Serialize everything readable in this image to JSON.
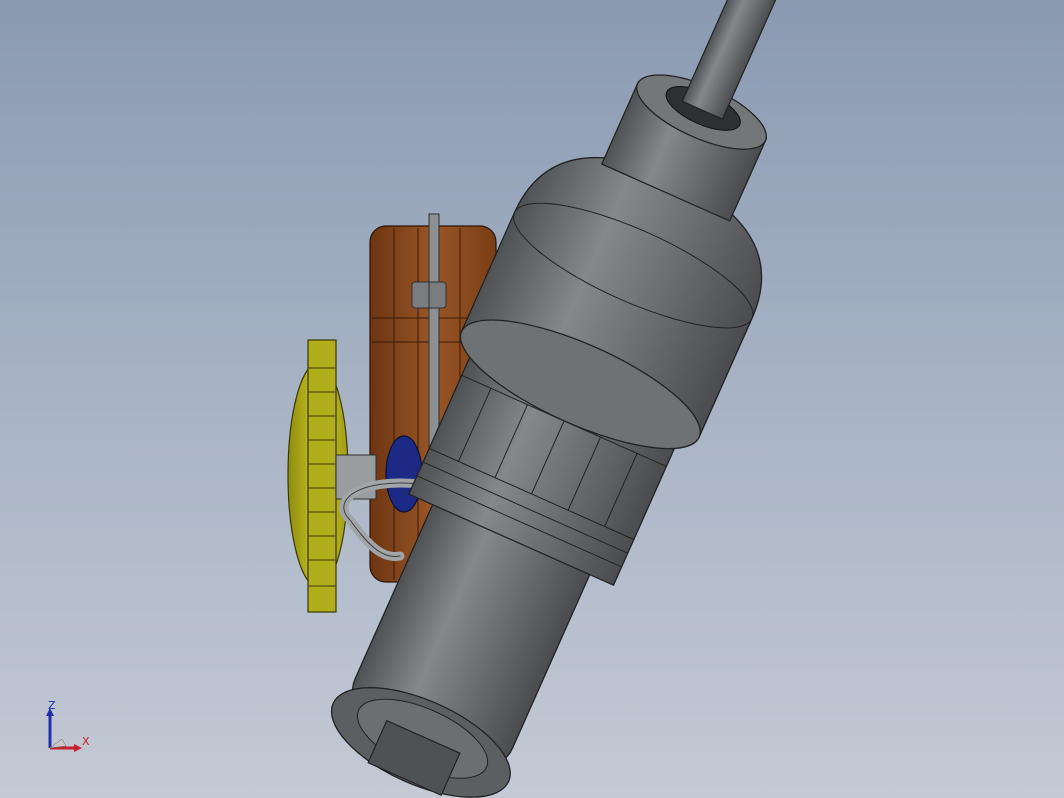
{
  "viewport": {
    "background_top": "#8a9ab1",
    "background_bottom": "#c3cad5",
    "model_colors": {
      "body_gray": "#6f7275",
      "housing_brown": "#8b4a1e",
      "blade_yellow": "#b7b41a",
      "motor_blue": "#1c2a86"
    }
  },
  "triad": {
    "z_label": "Z",
    "x_label": "X",
    "z_color": "#1f2fb0",
    "x_color": "#c8202a"
  }
}
